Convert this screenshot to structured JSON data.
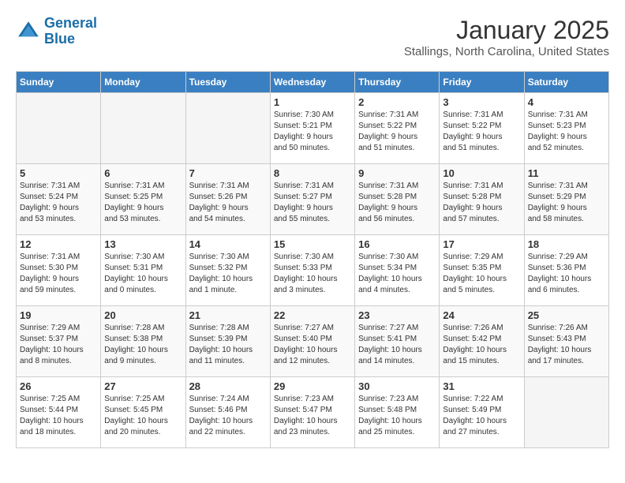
{
  "logo": {
    "line1": "General",
    "line2": "Blue"
  },
  "title": "January 2025",
  "location": "Stallings, North Carolina, United States",
  "days_of_week": [
    "Sunday",
    "Monday",
    "Tuesday",
    "Wednesday",
    "Thursday",
    "Friday",
    "Saturday"
  ],
  "weeks": [
    [
      {
        "day": "",
        "info": ""
      },
      {
        "day": "",
        "info": ""
      },
      {
        "day": "",
        "info": ""
      },
      {
        "day": "1",
        "info": "Sunrise: 7:30 AM\nSunset: 5:21 PM\nDaylight: 9 hours\nand 50 minutes."
      },
      {
        "day": "2",
        "info": "Sunrise: 7:31 AM\nSunset: 5:22 PM\nDaylight: 9 hours\nand 51 minutes."
      },
      {
        "day": "3",
        "info": "Sunrise: 7:31 AM\nSunset: 5:22 PM\nDaylight: 9 hours\nand 51 minutes."
      },
      {
        "day": "4",
        "info": "Sunrise: 7:31 AM\nSunset: 5:23 PM\nDaylight: 9 hours\nand 52 minutes."
      }
    ],
    [
      {
        "day": "5",
        "info": "Sunrise: 7:31 AM\nSunset: 5:24 PM\nDaylight: 9 hours\nand 53 minutes."
      },
      {
        "day": "6",
        "info": "Sunrise: 7:31 AM\nSunset: 5:25 PM\nDaylight: 9 hours\nand 53 minutes."
      },
      {
        "day": "7",
        "info": "Sunrise: 7:31 AM\nSunset: 5:26 PM\nDaylight: 9 hours\nand 54 minutes."
      },
      {
        "day": "8",
        "info": "Sunrise: 7:31 AM\nSunset: 5:27 PM\nDaylight: 9 hours\nand 55 minutes."
      },
      {
        "day": "9",
        "info": "Sunrise: 7:31 AM\nSunset: 5:28 PM\nDaylight: 9 hours\nand 56 minutes."
      },
      {
        "day": "10",
        "info": "Sunrise: 7:31 AM\nSunset: 5:28 PM\nDaylight: 9 hours\nand 57 minutes."
      },
      {
        "day": "11",
        "info": "Sunrise: 7:31 AM\nSunset: 5:29 PM\nDaylight: 9 hours\nand 58 minutes."
      }
    ],
    [
      {
        "day": "12",
        "info": "Sunrise: 7:31 AM\nSunset: 5:30 PM\nDaylight: 9 hours\nand 59 minutes."
      },
      {
        "day": "13",
        "info": "Sunrise: 7:30 AM\nSunset: 5:31 PM\nDaylight: 10 hours\nand 0 minutes."
      },
      {
        "day": "14",
        "info": "Sunrise: 7:30 AM\nSunset: 5:32 PM\nDaylight: 10 hours\nand 1 minute."
      },
      {
        "day": "15",
        "info": "Sunrise: 7:30 AM\nSunset: 5:33 PM\nDaylight: 10 hours\nand 3 minutes."
      },
      {
        "day": "16",
        "info": "Sunrise: 7:30 AM\nSunset: 5:34 PM\nDaylight: 10 hours\nand 4 minutes."
      },
      {
        "day": "17",
        "info": "Sunrise: 7:29 AM\nSunset: 5:35 PM\nDaylight: 10 hours\nand 5 minutes."
      },
      {
        "day": "18",
        "info": "Sunrise: 7:29 AM\nSunset: 5:36 PM\nDaylight: 10 hours\nand 6 minutes."
      }
    ],
    [
      {
        "day": "19",
        "info": "Sunrise: 7:29 AM\nSunset: 5:37 PM\nDaylight: 10 hours\nand 8 minutes."
      },
      {
        "day": "20",
        "info": "Sunrise: 7:28 AM\nSunset: 5:38 PM\nDaylight: 10 hours\nand 9 minutes."
      },
      {
        "day": "21",
        "info": "Sunrise: 7:28 AM\nSunset: 5:39 PM\nDaylight: 10 hours\nand 11 minutes."
      },
      {
        "day": "22",
        "info": "Sunrise: 7:27 AM\nSunset: 5:40 PM\nDaylight: 10 hours\nand 12 minutes."
      },
      {
        "day": "23",
        "info": "Sunrise: 7:27 AM\nSunset: 5:41 PM\nDaylight: 10 hours\nand 14 minutes."
      },
      {
        "day": "24",
        "info": "Sunrise: 7:26 AM\nSunset: 5:42 PM\nDaylight: 10 hours\nand 15 minutes."
      },
      {
        "day": "25",
        "info": "Sunrise: 7:26 AM\nSunset: 5:43 PM\nDaylight: 10 hours\nand 17 minutes."
      }
    ],
    [
      {
        "day": "26",
        "info": "Sunrise: 7:25 AM\nSunset: 5:44 PM\nDaylight: 10 hours\nand 18 minutes."
      },
      {
        "day": "27",
        "info": "Sunrise: 7:25 AM\nSunset: 5:45 PM\nDaylight: 10 hours\nand 20 minutes."
      },
      {
        "day": "28",
        "info": "Sunrise: 7:24 AM\nSunset: 5:46 PM\nDaylight: 10 hours\nand 22 minutes."
      },
      {
        "day": "29",
        "info": "Sunrise: 7:23 AM\nSunset: 5:47 PM\nDaylight: 10 hours\nand 23 minutes."
      },
      {
        "day": "30",
        "info": "Sunrise: 7:23 AM\nSunset: 5:48 PM\nDaylight: 10 hours\nand 25 minutes."
      },
      {
        "day": "31",
        "info": "Sunrise: 7:22 AM\nSunset: 5:49 PM\nDaylight: 10 hours\nand 27 minutes."
      },
      {
        "day": "",
        "info": ""
      }
    ]
  ]
}
